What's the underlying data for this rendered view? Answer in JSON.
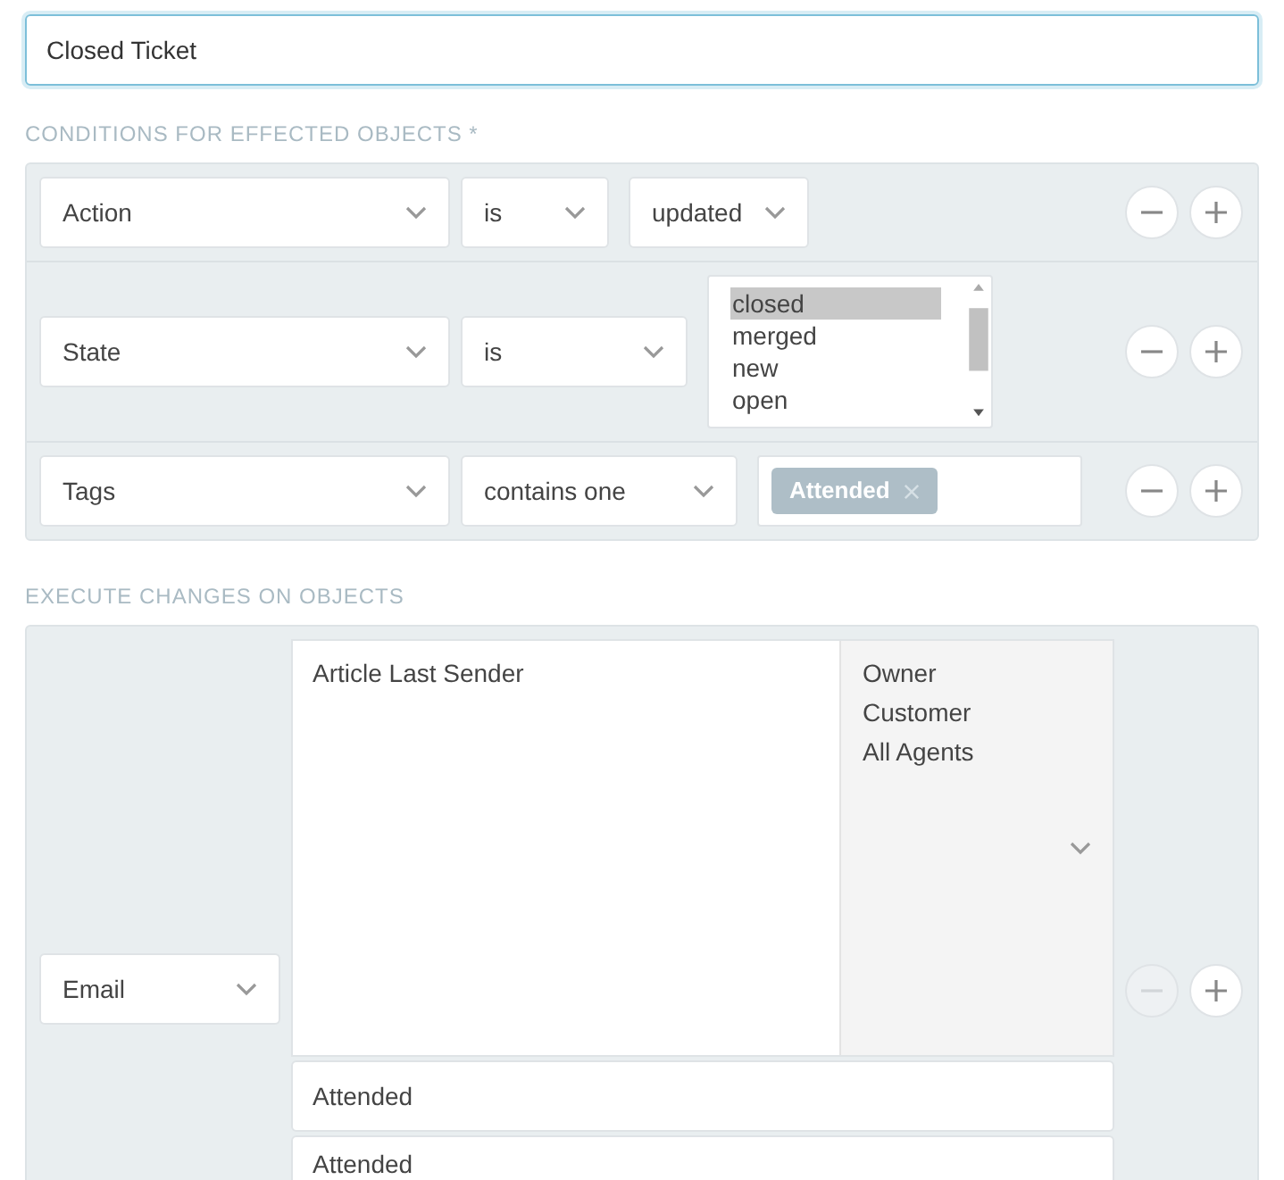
{
  "name_field": {
    "value": "Closed Ticket",
    "focused": true
  },
  "conditions": {
    "heading": "CONDITIONS FOR EFFECTED OBJECTS *",
    "rows": [
      {
        "kind": "select",
        "attribute": "Action",
        "operator": "is",
        "value": "updated"
      },
      {
        "kind": "listbox",
        "attribute": "State",
        "operator": "is",
        "options": [
          {
            "label": "closed",
            "selected": true
          },
          {
            "label": "merged",
            "selected": false
          },
          {
            "label": "new",
            "selected": false
          },
          {
            "label": "open",
            "selected": false
          }
        ]
      },
      {
        "kind": "tags",
        "attribute": "Tags",
        "operator": "contains one",
        "tags": [
          "Attended"
        ]
      }
    ]
  },
  "actions": {
    "heading": "EXECUTE CHANGES ON OBJECTS",
    "rows": [
      {
        "type": "Email",
        "recipients_selected": [
          "Article Last Sender"
        ],
        "recipients_available": [
          "Owner",
          "Customer",
          "All Agents"
        ],
        "fields": [
          "Attended",
          "Attended"
        ],
        "remove_disabled": true
      }
    ]
  }
}
